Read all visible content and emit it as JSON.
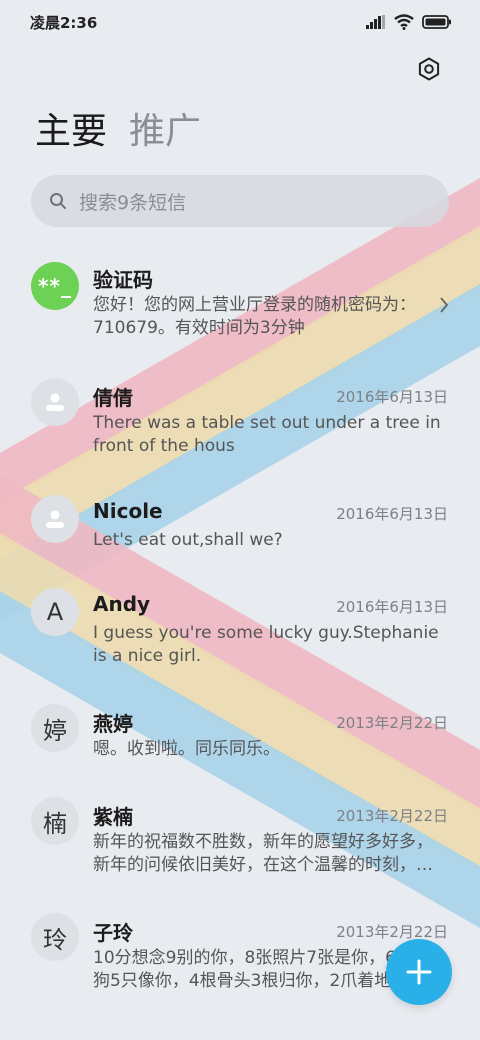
{
  "status_bar": {
    "time": "凌晨2:36"
  },
  "tabs": [
    {
      "label": "主要",
      "active": true
    },
    {
      "label": "推广",
      "active": false
    }
  ],
  "search": {
    "placeholder": "搜索9条短信"
  },
  "messages": [
    {
      "avatar": "**_",
      "name": "验证码",
      "date": "",
      "snippet": "您好！您的网上营业厅登录的随机密码为：710679。有效时间为3分钟"
    },
    {
      "avatar": "",
      "name": "倩倩",
      "date": "2016年6月13日",
      "snippet": "There was a table set out under a tree in front of the hous"
    },
    {
      "avatar": "",
      "name": "Nicole",
      "date": "2016年6月13日",
      "snippet": "Let's eat out,shall we?"
    },
    {
      "avatar": "A",
      "name": "Andy",
      "date": "2016年6月13日",
      "snippet": "I guess you're some lucky guy.Stephanie is a nice girl."
    },
    {
      "avatar": "婷",
      "name": "燕婷",
      "date": "2013年2月22日",
      "snippet": "嗯。收到啦。同乐同乐。"
    },
    {
      "avatar": "楠",
      "name": "紫楠",
      "date": "2013年2月22日",
      "snippet": "新年的祝福数不胜数，新年的愿望好多好多，新年的问候依旧美好，在这个温馨的时刻，…"
    },
    {
      "avatar": "玲",
      "name": "子玲",
      "date": "2013年2月22日",
      "snippet": "10分想念9别的你，8张照片7张是你，6条小狗5只像你，4根骨头3根归你，2爪着地"
    }
  ],
  "colors": {
    "accent": "#2ab0e9",
    "verify_avatar": "#6cd154",
    "stripe_pink": "#f0b8c2",
    "stripe_yellow": "#ecdcaf",
    "stripe_blue": "#a9d3e9"
  }
}
